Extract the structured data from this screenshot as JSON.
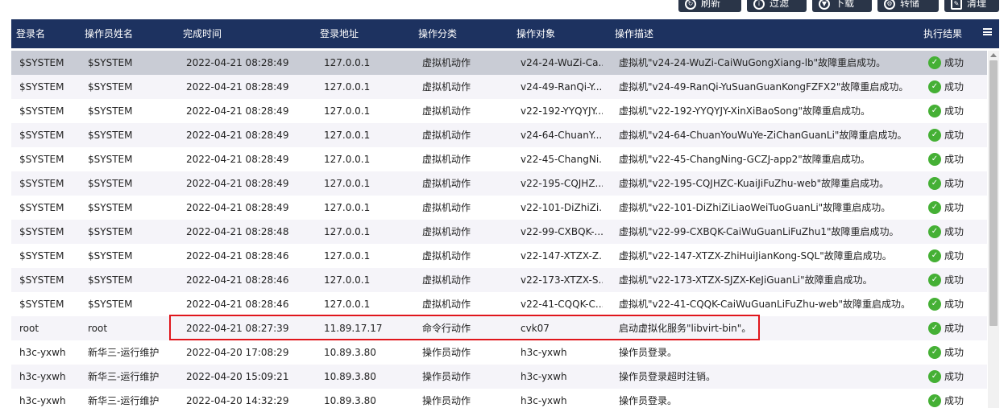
{
  "toolbar": {
    "buttons": [
      {
        "label": "刷新",
        "icon": "refresh-icon"
      },
      {
        "label": "过滤",
        "icon": "filter-icon"
      },
      {
        "label": "下载",
        "icon": "download-icon"
      },
      {
        "label": "转储",
        "icon": "export-icon"
      },
      {
        "label": "清理",
        "icon": "clear-icon"
      }
    ]
  },
  "table": {
    "columns": [
      "登录名",
      "操作员姓名",
      "完成时间",
      "登录地址",
      "操作分类",
      "操作对象",
      "操作描述",
      "执行结果"
    ],
    "rows": [
      {
        "login": "$SYSTEM",
        "name": "$SYSTEM",
        "time": "2022-04-21 08:28:49",
        "addr": "127.0.0.1",
        "cat": "虚拟机动作",
        "target": "v24-24-WuZi-Ca...",
        "desc": "虚拟机\"v24-24-WuZi-CaiWuGongXiang-lb\"故障重启成功。",
        "result": "成功"
      },
      {
        "login": "$SYSTEM",
        "name": "$SYSTEM",
        "time": "2022-04-21 08:28:49",
        "addr": "127.0.0.1",
        "cat": "虚拟机动作",
        "target": "v24-49-RanQi-Y...",
        "desc": "虚拟机\"v24-49-RanQi-YuSuanGuanKongFZFX2\"故障重启成功。",
        "result": "成功"
      },
      {
        "login": "$SYSTEM",
        "name": "$SYSTEM",
        "time": "2022-04-21 08:28:49",
        "addr": "127.0.0.1",
        "cat": "虚拟机动作",
        "target": "v22-192-YYQYJY...",
        "desc": "虚拟机\"v22-192-YYQYJY-XinXiBaoSong\"故障重启成功。",
        "result": "成功"
      },
      {
        "login": "$SYSTEM",
        "name": "$SYSTEM",
        "time": "2022-04-21 08:28:49",
        "addr": "127.0.0.1",
        "cat": "虚拟机动作",
        "target": "v24-64-ChuanY...",
        "desc": "虚拟机\"v24-64-ChuanYouWuYe-ZiChanGuanLi\"故障重启成功。",
        "result": "成功"
      },
      {
        "login": "$SYSTEM",
        "name": "$SYSTEM",
        "time": "2022-04-21 08:28:49",
        "addr": "127.0.0.1",
        "cat": "虚拟机动作",
        "target": "v22-45-ChangNi...",
        "desc": "虚拟机\"v22-45-ChangNing-GCZJ-app2\"故障重启成功。",
        "result": "成功"
      },
      {
        "login": "$SYSTEM",
        "name": "$SYSTEM",
        "time": "2022-04-21 08:28:49",
        "addr": "127.0.0.1",
        "cat": "虚拟机动作",
        "target": "v22-195-CQJHZ...",
        "desc": "虚拟机\"v22-195-CQJHZC-KuaiJiFuZhu-web\"故障重启成功。",
        "result": "成功"
      },
      {
        "login": "$SYSTEM",
        "name": "$SYSTEM",
        "time": "2022-04-21 08:28:49",
        "addr": "127.0.0.1",
        "cat": "虚拟机动作",
        "target": "v22-101-DiZhiZi...",
        "desc": "虚拟机\"v22-101-DiZhiZiLiaoWeiTuoGuanLi\"故障重启成功。",
        "result": "成功"
      },
      {
        "login": "$SYSTEM",
        "name": "$SYSTEM",
        "time": "2022-04-21 08:28:48",
        "addr": "127.0.0.1",
        "cat": "虚拟机动作",
        "target": "v22-99-CXBQK-...",
        "desc": "虚拟机\"v22-99-CXBQK-CaiWuGuanLiFuZhu1\"故障重启成功。",
        "result": "成功"
      },
      {
        "login": "$SYSTEM",
        "name": "$SYSTEM",
        "time": "2022-04-21 08:28:46",
        "addr": "127.0.0.1",
        "cat": "虚拟机动作",
        "target": "v22-147-XTZX-Z...",
        "desc": "虚拟机\"v22-147-XTZX-ZhiHuiJianKong-SQL\"故障重启成功。",
        "result": "成功"
      },
      {
        "login": "$SYSTEM",
        "name": "$SYSTEM",
        "time": "2022-04-21 08:28:46",
        "addr": "127.0.0.1",
        "cat": "虚拟机动作",
        "target": "v22-173-XTZX-S...",
        "desc": "虚拟机\"v22-173-XTZX-SJZX-KeJiGuanLi\"故障重启成功。",
        "result": "成功"
      },
      {
        "login": "$SYSTEM",
        "name": "$SYSTEM",
        "time": "2022-04-21 08:28:46",
        "addr": "127.0.0.1",
        "cat": "虚拟机动作",
        "target": "v22-41-CQQK-C...",
        "desc": "虚拟机\"v22-41-CQQK-CaiWuGuanLiFuZhu-web\"故障重启成功。",
        "result": "成功"
      },
      {
        "login": "root",
        "name": "root",
        "time": "2022-04-21 08:27:39",
        "addr": "11.89.17.17",
        "cat": "命令行动作",
        "target": "cvk07",
        "desc": "启动虚拟化服务\"libvirt-bin\"。",
        "result": "成功"
      },
      {
        "login": "h3c-yxwh",
        "name": "新华三-运行维护",
        "time": "2022-04-20 17:08:29",
        "addr": "10.89.3.80",
        "cat": "操作员动作",
        "target": "h3c-yxwh",
        "desc": "操作员登录。",
        "result": "成功"
      },
      {
        "login": "h3c-yxwh",
        "name": "新华三-运行维护",
        "time": "2022-04-20 15:09:21",
        "addr": "10.89.3.80",
        "cat": "操作员动作",
        "target": "h3c-yxwh",
        "desc": "操作员登录超时注销。",
        "result": "成功"
      },
      {
        "login": "h3c-yxwh",
        "name": "新华三-运行维护",
        "time": "2022-04-20 14:32:29",
        "addr": "10.89.3.80",
        "cat": "操作员动作",
        "target": "h3c-yxwh",
        "desc": "操作员登录。",
        "result": "成功"
      }
    ]
  },
  "colors": {
    "header_bg": "#1d3260",
    "toolbar_bg": "#2a3548",
    "selected_row": "#c9ccd5",
    "alt_row": "#f5f4f9",
    "success": "#45b035",
    "highlight": "#e0161c"
  }
}
